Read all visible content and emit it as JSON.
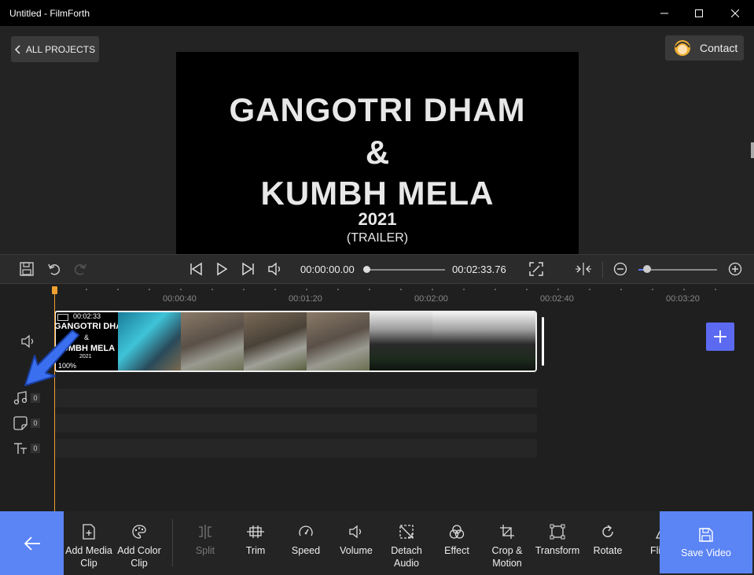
{
  "window": {
    "title": "Untitled - FilmForth"
  },
  "header": {
    "back_label": "ALL PROJECTS",
    "contact_label": "Contact"
  },
  "preview": {
    "line1": "GANGOTRI DHAM",
    "line2": "&",
    "line3": "KUMBH MELA",
    "line4": "2021",
    "line5": "(TRAILER)"
  },
  "playback": {
    "current_time": "00:00:00.00",
    "total_time": "00:02:33.76",
    "progress": 0.0,
    "zoom_level": 0.1
  },
  "ruler": {
    "labels": [
      "00:00:40",
      "00:01:20",
      "00:02:00",
      "00:02:40",
      "00:03:20"
    ]
  },
  "clip": {
    "duration": "00:02:33",
    "title_line1": "GANGOTRI DHA",
    "title_line2": "&",
    "title_line3": "KUMBH MELA",
    "title_line4": "2021",
    "volume": "100%"
  },
  "tracks": {
    "music_count": "0",
    "sticker_count": "0",
    "text_count": "0"
  },
  "toolbar": {
    "tools": [
      {
        "label1": "Add Media",
        "label2": "Clip"
      },
      {
        "label1": "Add Color",
        "label2": "Clip"
      },
      {
        "label1": "Split",
        "label2": ""
      },
      {
        "label1": "Trim",
        "label2": ""
      },
      {
        "label1": "Speed",
        "label2": ""
      },
      {
        "label1": "Volume",
        "label2": ""
      },
      {
        "label1": "Detach",
        "label2": "Audio"
      },
      {
        "label1": "Effect",
        "label2": ""
      },
      {
        "label1": "Crop &",
        "label2": "Motion"
      },
      {
        "label1": "Transform",
        "label2": ""
      },
      {
        "label1": "Rotate",
        "label2": ""
      },
      {
        "label1": "Fli",
        "label2": ""
      }
    ],
    "save_label": "Save Video"
  },
  "colors": {
    "accent": "#5b84f5",
    "playhead": "#f0a030",
    "add_button": "#5b6af0"
  }
}
